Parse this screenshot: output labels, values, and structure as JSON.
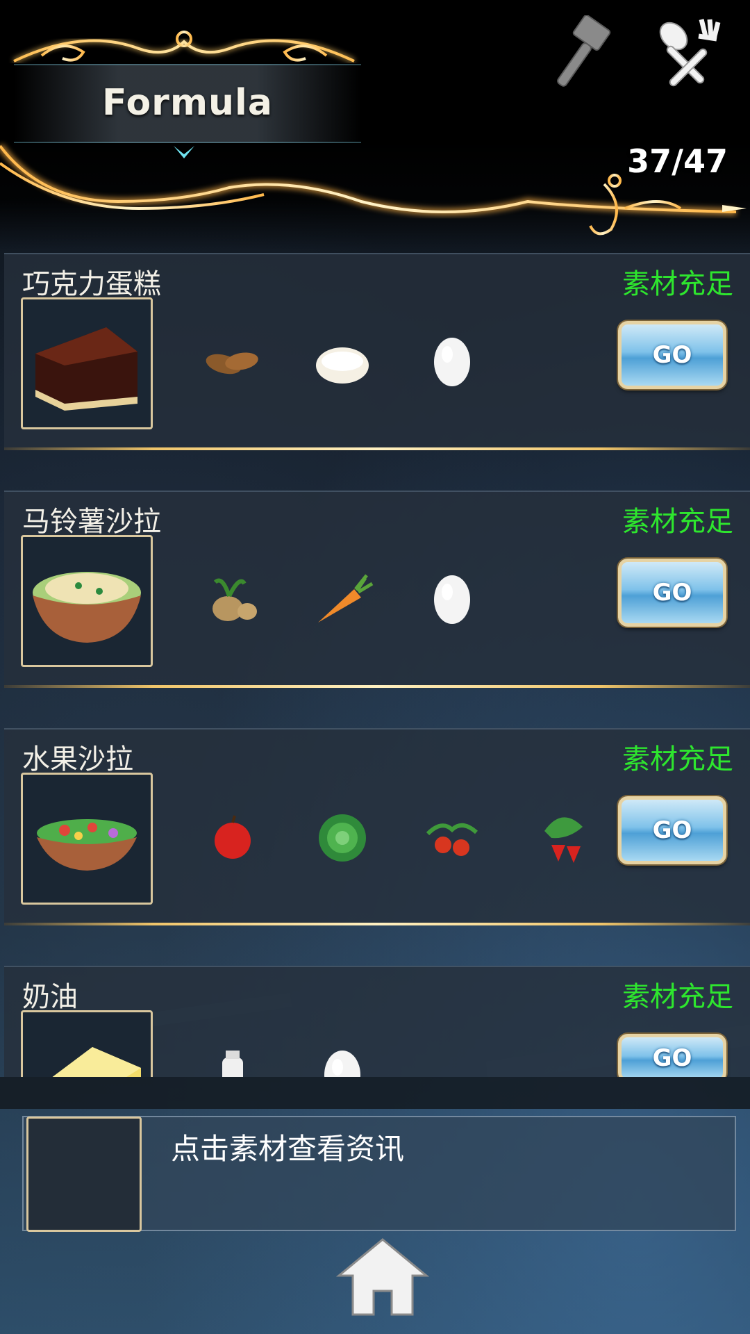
{
  "header": {
    "title": "Formula",
    "counter": "37/47",
    "icons": [
      "hammer-icon",
      "fork-spoon-icon"
    ]
  },
  "recipes": [
    {
      "name": "巧克力蛋糕",
      "status": "素材充足",
      "go_label": "GO",
      "image": "chocolate-cake",
      "ingredients": [
        "almond",
        "dough",
        "egg"
      ]
    },
    {
      "name": "马铃薯沙拉",
      "status": "素材充足",
      "go_label": "GO",
      "image": "potato-salad",
      "ingredients": [
        "potato",
        "carrot",
        "egg"
      ]
    },
    {
      "name": "水果沙拉",
      "status": "素材充足",
      "go_label": "GO",
      "image": "fruit-salad",
      "ingredients": [
        "apple",
        "cabbage",
        "tomato",
        "strawberry"
      ]
    },
    {
      "name": "奶油",
      "status": "素材充足",
      "go_label": "GO",
      "image": "butter",
      "ingredients": [
        "milk",
        "egg"
      ]
    }
  ],
  "info_panel": {
    "hint": "点击素材查看资讯"
  },
  "footer": {
    "home_icon": "home-icon"
  },
  "colors": {
    "status_green": "#2ee62e",
    "gold_accent": "#f0c56a",
    "frame_border": "#d9c79e"
  }
}
